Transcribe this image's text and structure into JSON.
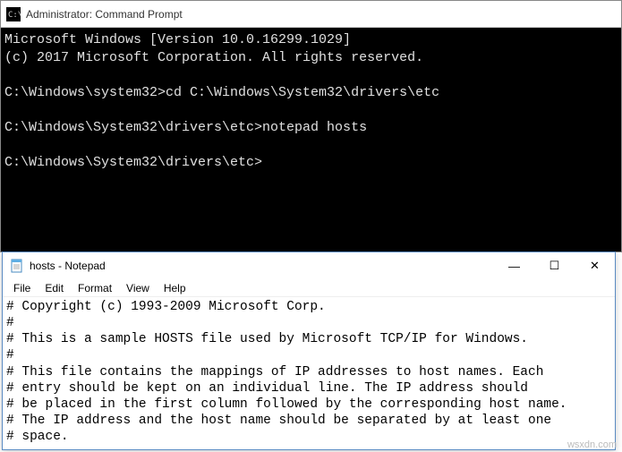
{
  "cmd": {
    "title": "Administrator: Command Prompt",
    "lines": [
      "Microsoft Windows [Version 10.0.16299.1029]",
      "(c) 2017 Microsoft Corporation. All rights reserved.",
      "",
      "C:\\Windows\\system32>cd C:\\Windows\\System32\\drivers\\etc",
      "",
      "C:\\Windows\\System32\\drivers\\etc>notepad hosts",
      "",
      "C:\\Windows\\System32\\drivers\\etc>"
    ]
  },
  "notepad": {
    "title": "hosts - Notepad",
    "menu": {
      "file": "File",
      "edit": "Edit",
      "format": "Format",
      "view": "View",
      "help": "Help"
    },
    "controls": {
      "minimize": "—",
      "maximize": "☐",
      "close": "✕"
    },
    "lines": [
      "# Copyright (c) 1993-2009 Microsoft Corp.",
      "#",
      "# This is a sample HOSTS file used by Microsoft TCP/IP for Windows.",
      "#",
      "# This file contains the mappings of IP addresses to host names. Each",
      "# entry should be kept on an individual line. The IP address should",
      "# be placed in the first column followed by the corresponding host name.",
      "# The IP address and the host name should be separated by at least one",
      "# space."
    ]
  },
  "watermark": "wsxdn.com"
}
